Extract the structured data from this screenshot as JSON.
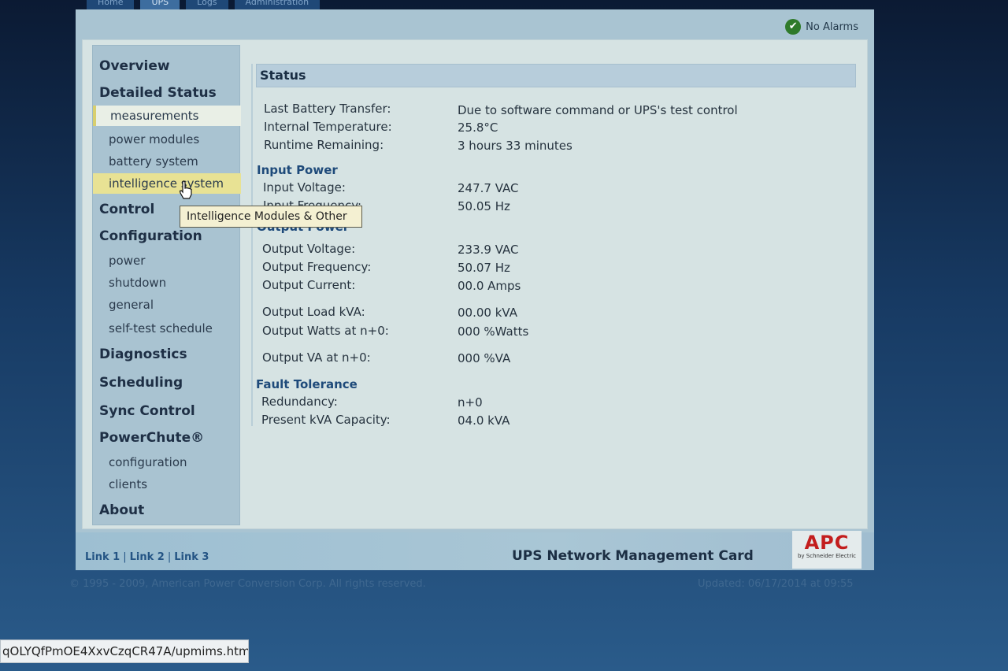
{
  "tabs": [
    "Home",
    "UPS",
    "Logs",
    "Administration"
  ],
  "alarm": {
    "text": "No Alarms"
  },
  "sidebar": {
    "overview": "Overview",
    "detailed_status": "Detailed Status",
    "measurements": "measurements",
    "power_modules": "power modules",
    "battery_system": "battery system",
    "intelligence_system": "intelligence system",
    "control": "Control",
    "configuration": "Configuration",
    "power": "power",
    "shutdown": "shutdown",
    "general": "general",
    "self_test_schedule": "self-test schedule",
    "diagnostics": "Diagnostics",
    "scheduling": "Scheduling",
    "sync_control": "Sync Control",
    "powerchute": "PowerChute®",
    "pc_configuration": "configuration",
    "pc_clients": "clients",
    "about": "About"
  },
  "tooltip": "Intelligence Modules & Other",
  "status": {
    "header": "Status",
    "rows": [
      {
        "label": "Last Battery Transfer:",
        "value": "Due to software command or UPS's test control"
      },
      {
        "label": "Internal Temperature:",
        "value": "25.8°C"
      },
      {
        "label": "Runtime Remaining:",
        "value": "3 hours 33 minutes"
      }
    ]
  },
  "input_power": {
    "header": "Input Power",
    "rows": [
      {
        "label": "Input Voltage:",
        "value": "247.7 VAC"
      },
      {
        "label": "Input Frequency:",
        "value": "50.05 Hz"
      }
    ]
  },
  "output_power": {
    "header": "Output Power",
    "rows": [
      {
        "label": "Output Voltage:",
        "value": "233.9 VAC"
      },
      {
        "label": "Output Frequency:",
        "value": "50.07 Hz"
      },
      {
        "label": "Output Current:",
        "value": "00.0 Amps"
      },
      {
        "label": "Output Load kVA:",
        "value": "00.00 kVA"
      },
      {
        "label": "Output Watts at n+0:",
        "value": "000 %Watts"
      },
      {
        "label": "Output VA at n+0:",
        "value": "000 %VA"
      }
    ]
  },
  "fault_tolerance": {
    "header": "Fault Tolerance",
    "rows": [
      {
        "label": "Redundancy:",
        "value": "n+0"
      },
      {
        "label": "Present kVA Capacity:",
        "value": "04.0 kVA"
      }
    ]
  },
  "footer": {
    "link1": "Link 1",
    "link2": "Link 2",
    "link3": "Link 3",
    "separator": "|",
    "card_title": "UPS Network Management Card",
    "logo": "APC",
    "logo_sub": "by Schneider Electric",
    "copyright": "© 1995 - 2009, American Power Conversion Corp. All rights reserved.",
    "updated": "Updated: 06/17/2014 at 09:55"
  },
  "browser_status_url": "qOLYQfPmOE4XxvCzqCR47A/upmims.htm"
}
